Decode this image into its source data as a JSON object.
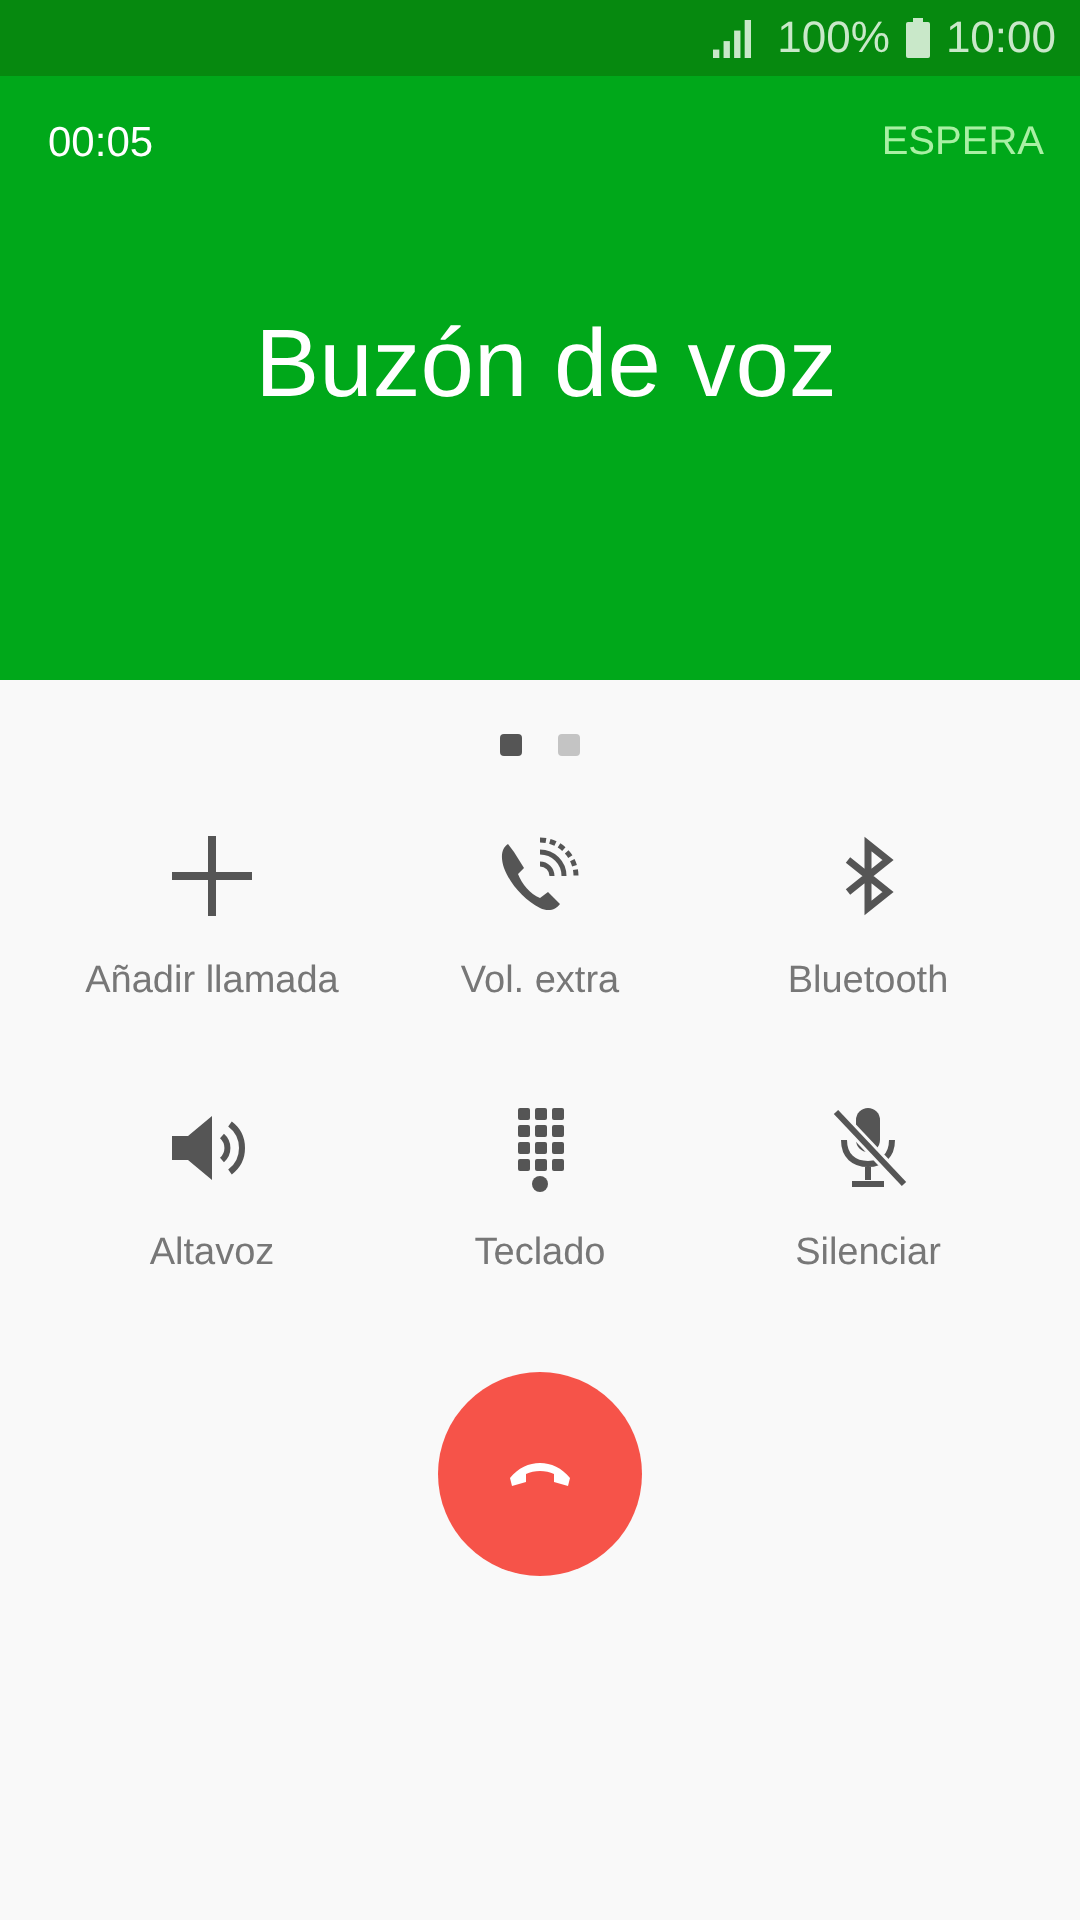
{
  "status_bar": {
    "battery": "100%",
    "time": "10:00"
  },
  "call": {
    "timer": "00:05",
    "hold_button": "ESPERA",
    "name": "Buzón de voz"
  },
  "page_dots": [
    {
      "selected": true
    },
    {
      "selected": false
    }
  ],
  "actions": [
    {
      "kind": "add",
      "label": "Añadir llamada"
    },
    {
      "kind": "volume",
      "label": "Vol. extra"
    },
    {
      "kind": "bluetooth",
      "label": "Bluetooth"
    },
    {
      "kind": "speaker",
      "label": "Altavoz"
    },
    {
      "kind": "keypad",
      "label": "Teclado"
    },
    {
      "kind": "mute",
      "label": "Silenciar"
    }
  ]
}
